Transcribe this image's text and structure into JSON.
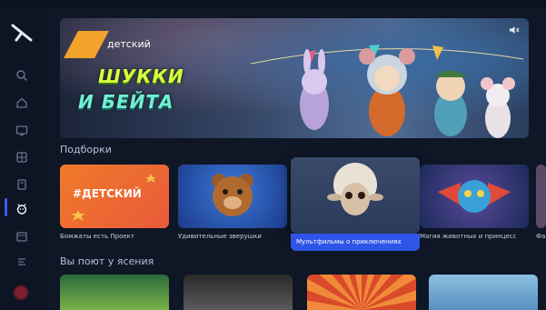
{
  "sidebar": {
    "nav": [
      {
        "icon": "search-icon"
      },
      {
        "icon": "home-icon"
      },
      {
        "icon": "tv-icon"
      },
      {
        "icon": "movie-icon"
      },
      {
        "icon": "series-icon"
      },
      {
        "icon": "kids-icon",
        "active": true
      },
      {
        "icon": "calendar-icon"
      },
      {
        "icon": "sports-icon"
      }
    ]
  },
  "hero": {
    "category": "детский",
    "title_line1": "ШУККИ",
    "title_line2": "И БЕЙТА"
  },
  "sections": {
    "collections_title": "Подборки",
    "continue_title": "Вы поют у ясения"
  },
  "cards": [
    {
      "label": "Бомжаты есть Проект",
      "badge": "#ДЕТСКИЙ"
    },
    {
      "label": "Удивительные зверушки"
    },
    {
      "label": "Мультфильмы о приключениях",
      "featured": true
    },
    {
      "label": "Магия животных и принцесс"
    },
    {
      "label": "Фан"
    }
  ],
  "colors": {
    "accent": "#2f55e8",
    "hero_stripe": "#f3a22b",
    "title_yellow": "#d9ff3b",
    "title_mint": "#6ff0d4"
  }
}
